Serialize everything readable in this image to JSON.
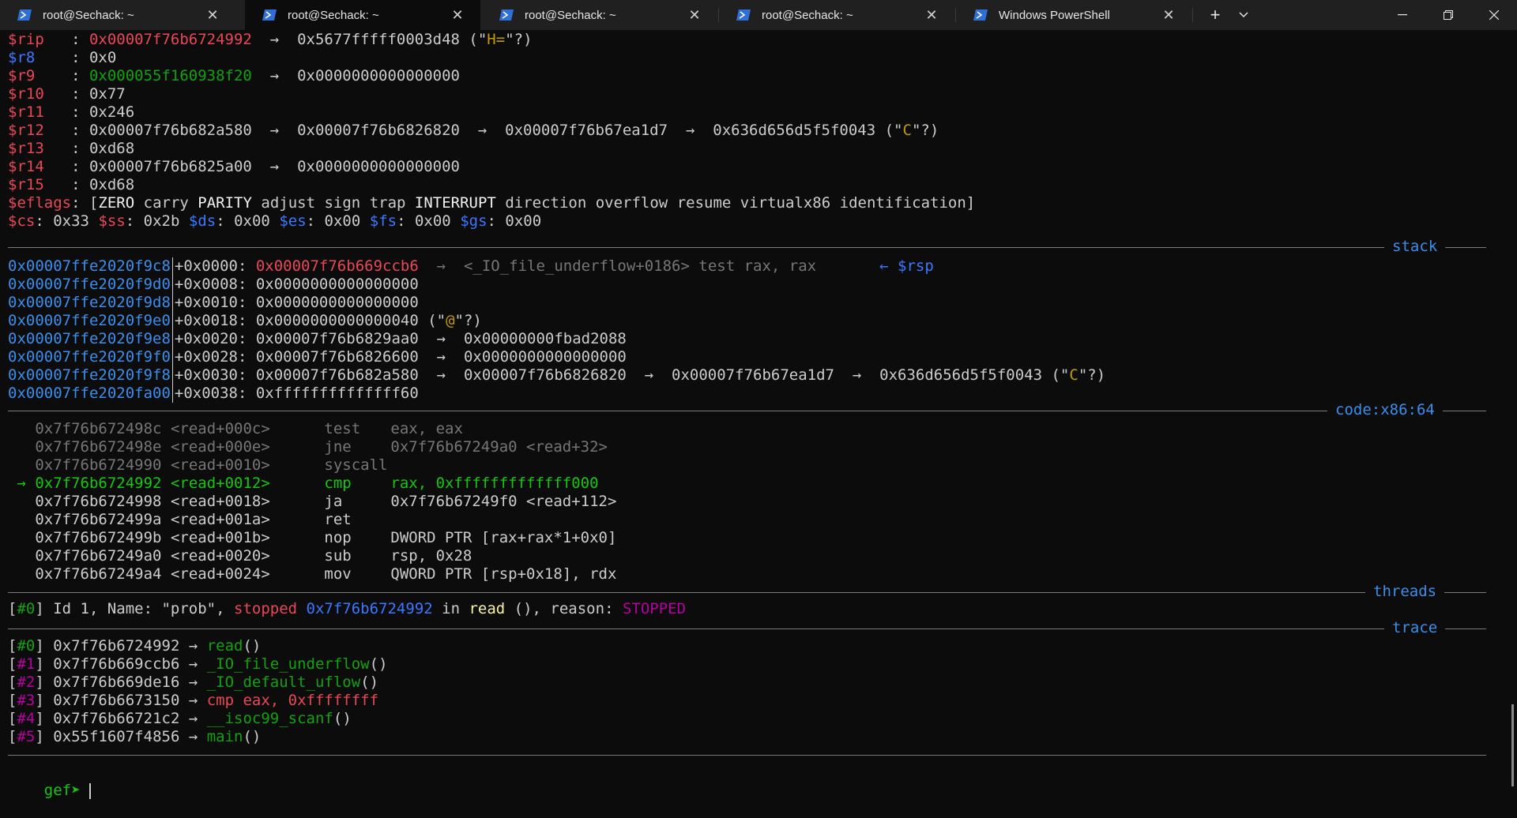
{
  "tabs": [
    {
      "label": "root@Sechack: ~",
      "active": false
    },
    {
      "label": "root@Sechack: ~",
      "active": true
    },
    {
      "label": "root@Sechack: ~",
      "active": false
    },
    {
      "label": "root@Sechack: ~",
      "active": false
    },
    {
      "label": "Windows PowerShell",
      "active": false
    }
  ],
  "tabbar": {
    "new_tab": "+",
    "dropdown": "⌄",
    "close_glyph": "✕"
  },
  "window": {
    "minimize": "—",
    "restore": "❐",
    "close": "✕"
  },
  "registers": [
    {
      "name": "$rip",
      "name_color": "red",
      "sep": "   : ",
      "parts": [
        {
          "t": "0x00007f76b6724992",
          "c": "red"
        },
        {
          "t": "  →  0x5677fffff0003d48 (\"",
          "c": "white"
        },
        {
          "t": "H=",
          "c": "orange"
        },
        {
          "t": "\"?)",
          "c": "white"
        }
      ]
    },
    {
      "name": "$r8",
      "name_color": "blue",
      "sep": "    : ",
      "parts": [
        {
          "t": "0x0",
          "c": "white"
        }
      ]
    },
    {
      "name": "$r9",
      "name_color": "red",
      "sep": "    : ",
      "parts": [
        {
          "t": "0x000055f160938f20",
          "c": "dgreen"
        },
        {
          "t": "  →  0x0000000000000000",
          "c": "white"
        }
      ]
    },
    {
      "name": "$r10",
      "name_color": "red",
      "sep": "   : ",
      "parts": [
        {
          "t": "0x77",
          "c": "white"
        }
      ]
    },
    {
      "name": "$r11",
      "name_color": "red",
      "sep": "   : ",
      "parts": [
        {
          "t": "0x246",
          "c": "white"
        }
      ]
    },
    {
      "name": "$r12",
      "name_color": "red",
      "sep": "   : ",
      "parts": [
        {
          "t": "0x00007f76b682a580  →  0x00007f76b6826820  →  0x00007f76b67ea1d7  →  0x636d656d5f5f0043 (\"",
          "c": "white"
        },
        {
          "t": "C",
          "c": "orange"
        },
        {
          "t": "\"?)",
          "c": "white"
        }
      ]
    },
    {
      "name": "$r13",
      "name_color": "red",
      "sep": "   : ",
      "parts": [
        {
          "t": "0xd68",
          "c": "white"
        }
      ]
    },
    {
      "name": "$r14",
      "name_color": "red",
      "sep": "   : ",
      "parts": [
        {
          "t": "0x00007f76b6825a00  →  0x0000000000000000",
          "c": "white"
        }
      ]
    },
    {
      "name": "$r15",
      "name_color": "red",
      "sep": "   : ",
      "parts": [
        {
          "t": "0xd68",
          "c": "white"
        }
      ]
    }
  ],
  "eflags": {
    "name": "$eflags",
    "sep": ": [",
    "flags": [
      {
        "t": "ZERO",
        "c": "bwhite"
      },
      {
        "t": "carry",
        "c": "white"
      },
      {
        "t": "PARITY",
        "c": "bwhite"
      },
      {
        "t": "adjust",
        "c": "white"
      },
      {
        "t": "sign",
        "c": "white"
      },
      {
        "t": "trap",
        "c": "white"
      },
      {
        "t": "INTERRUPT",
        "c": "bwhite"
      },
      {
        "t": "direction",
        "c": "white"
      },
      {
        "t": "overflow",
        "c": "white"
      },
      {
        "t": "resume",
        "c": "white"
      },
      {
        "t": "virtualx86",
        "c": "white"
      },
      {
        "t": "identification",
        "c": "white"
      }
    ],
    "end": "]"
  },
  "segments": [
    {
      "name": "$cs",
      "c": "red",
      "val": "0x33"
    },
    {
      "name": "$ss",
      "c": "red",
      "val": "0x2b"
    },
    {
      "name": "$ds",
      "c": "blue",
      "val": "0x00"
    },
    {
      "name": "$es",
      "c": "blue",
      "val": "0x00"
    },
    {
      "name": "$fs",
      "c": "blue",
      "val": "0x00"
    },
    {
      "name": "$gs",
      "c": "blue",
      "val": "0x00"
    }
  ],
  "sections": {
    "stack": "stack",
    "code": "code:x86:64",
    "threads": "threads",
    "trace": "trace"
  },
  "stack": [
    {
      "addr": "0x00007ffe2020f9c8",
      "off": "+0x0000: ",
      "parts": [
        {
          "t": "0x00007f76b669ccb6",
          "c": "red"
        },
        {
          "t": "  →  <_IO_file_underflow+0186> test rax, rax       ",
          "c": "gray"
        },
        {
          "t": "← $rsp",
          "c": "blue"
        }
      ]
    },
    {
      "addr": "0x00007ffe2020f9d0",
      "off": "+0x0008: ",
      "parts": [
        {
          "t": "0x0000000000000000",
          "c": "white"
        }
      ]
    },
    {
      "addr": "0x00007ffe2020f9d8",
      "off": "+0x0010: ",
      "parts": [
        {
          "t": "0x0000000000000000",
          "c": "white"
        }
      ]
    },
    {
      "addr": "0x00007ffe2020f9e0",
      "off": "+0x0018: ",
      "parts": [
        {
          "t": "0x0000000000000040 (\"",
          "c": "white"
        },
        {
          "t": "@",
          "c": "orange"
        },
        {
          "t": "\"?)",
          "c": "white"
        }
      ]
    },
    {
      "addr": "0x00007ffe2020f9e8",
      "off": "+0x0020: ",
      "parts": [
        {
          "t": "0x00007f76b6829aa0  →  0x00000000fbad2088",
          "c": "white"
        }
      ]
    },
    {
      "addr": "0x00007ffe2020f9f0",
      "off": "+0x0028: ",
      "parts": [
        {
          "t": "0x00007f76b6826600  →  0x0000000000000000",
          "c": "white"
        }
      ]
    },
    {
      "addr": "0x00007ffe2020f9f8",
      "off": "+0x0030: ",
      "parts": [
        {
          "t": "0x00007f76b682a580  →  0x00007f76b6826820  →  0x00007f76b67ea1d7  →  0x636d656d5f5f0043 (\"",
          "c": "white"
        },
        {
          "t": "C",
          "c": "orange"
        },
        {
          "t": "\"?)",
          "c": "white"
        }
      ]
    },
    {
      "addr": "0x00007ffe2020fa00",
      "off": "+0x0038: ",
      "parts": [
        {
          "t": "0xffffffffffffff60",
          "c": "white"
        }
      ]
    }
  ],
  "code": [
    {
      "marker": "   ",
      "addr": "0x7f76b672498c",
      "sym": "<read+000c>",
      "op": "test",
      "args": "eax, eax",
      "style": "gray"
    },
    {
      "marker": "   ",
      "addr": "0x7f76b672498e",
      "sym": "<read+000e>",
      "op": "jne",
      "args": "0x7f76b67249a0 <read+32>",
      "style": "gray"
    },
    {
      "marker": "   ",
      "addr": "0x7f76b6724990",
      "sym": "<read+0010>",
      "op": "syscall",
      "args": "",
      "style": "gray"
    },
    {
      "marker": " → ",
      "addr": "0x7f76b6724992",
      "sym": "<read+0012>",
      "op": "cmp",
      "args": "rax, 0xfffffffffffff000",
      "style": "green"
    },
    {
      "marker": "   ",
      "addr": "0x7f76b6724998",
      "sym": "<read+0018>",
      "op": "ja",
      "args": "0x7f76b67249f0 <read+112>",
      "style": "white"
    },
    {
      "marker": "   ",
      "addr": "0x7f76b672499a",
      "sym": "<read+001a>",
      "op": "ret",
      "args": "",
      "style": "white"
    },
    {
      "marker": "   ",
      "addr": "0x7f76b672499b",
      "sym": "<read+001b>",
      "op": "nop",
      "args": "DWORD PTR [rax+rax*1+0x0]",
      "style": "white"
    },
    {
      "marker": "   ",
      "addr": "0x7f76b67249a0",
      "sym": "<read+0020>",
      "op": "sub",
      "args": "rsp, 0x28",
      "style": "white"
    },
    {
      "marker": "   ",
      "addr": "0x7f76b67249a4",
      "sym": "<read+0024>",
      "op": "mov",
      "args": "QWORD PTR [rsp+0x18], rdx",
      "style": "white"
    }
  ],
  "thread": {
    "parts": [
      {
        "t": "[",
        "c": "white"
      },
      {
        "t": "#0",
        "c": "dgreen"
      },
      {
        "t": "] Id 1, Name: \"prob\", ",
        "c": "white"
      },
      {
        "t": "stopped",
        "c": "red"
      },
      {
        "t": " ",
        "c": "white"
      },
      {
        "t": "0x7f76b6724992",
        "c": "blue"
      },
      {
        "t": " in ",
        "c": "white"
      },
      {
        "t": "read",
        "c": "yellow"
      },
      {
        "t": " (), reason: ",
        "c": "white"
      },
      {
        "t": "STOPPED",
        "c": "mag"
      }
    ]
  },
  "trace": [
    {
      "idx": "#0",
      "idx_c": "dgreen",
      "addr": "0x7f76b6724992",
      "fn": "read",
      "fn_c": "dgreen",
      "tail": "()"
    },
    {
      "idx": "#1",
      "idx_c": "mag",
      "addr": "0x7f76b669ccb6",
      "fn": "_IO_file_underflow",
      "fn_c": "dgreen",
      "tail": "()"
    },
    {
      "idx": "#2",
      "idx_c": "mag",
      "addr": "0x7f76b669de16",
      "fn": "_IO_default_uflow",
      "fn_c": "dgreen",
      "tail": "()"
    },
    {
      "idx": "#3",
      "idx_c": "mag",
      "addr": "0x7f76b6673150",
      "fn": "cmp eax, 0xffffffff",
      "fn_c": "red",
      "tail": ""
    },
    {
      "idx": "#4",
      "idx_c": "mag",
      "addr": "0x7f76b66721c2",
      "fn": "__isoc99_scanf",
      "fn_c": "dgreen",
      "tail": "()"
    },
    {
      "idx": "#5",
      "idx_c": "mag",
      "addr": "0x55f1607f4856",
      "fn": "main",
      "fn_c": "dgreen",
      "tail": "()"
    }
  ],
  "prompt": {
    "text": "gef➤ ",
    "input": ""
  },
  "colors": {
    "background": "#0c0c0c",
    "tabbar": "#202020",
    "section_label": "#3b8eea"
  }
}
